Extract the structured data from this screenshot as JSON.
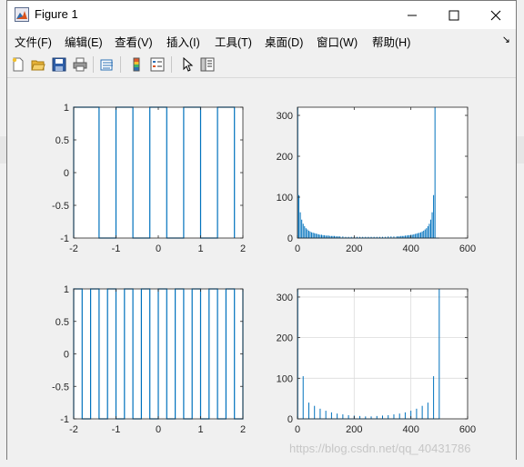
{
  "window": {
    "title": "Figure 1"
  },
  "icons": {
    "title": "matlab-figure-icon",
    "minimize": "minimize-icon",
    "maximize": "maximize-icon",
    "close": "close-icon",
    "new": "new-figure-icon",
    "open": "open-file-icon",
    "save": "save-icon",
    "print": "print-icon",
    "link": "link-plot-icon",
    "colorbar": "colorbar-icon",
    "legend": "legend-icon",
    "pointer": "edit-plot-icon",
    "property": "property-inspector-icon"
  },
  "menu": [
    "文件(F)",
    "编辑(E)",
    "查看(V)",
    "插入(I)",
    "工具(T)",
    "桌面(D)",
    "窗口(W)",
    "帮助(H)"
  ],
  "menu_corner": "↘",
  "watermark": "https://blog.csdn.net/qq_40431786",
  "colors": {
    "line": "#0072bd",
    "axes_bg": "#ffffff",
    "figure_bg": "#f0f0f0",
    "grid": "#dcdcdc"
  },
  "chart_data": [
    {
      "type": "line",
      "title": "",
      "xlabel": "",
      "ylabel": "",
      "xlim": [
        -2,
        2
      ],
      "ylim": [
        -1,
        1
      ],
      "xticks": [
        -2,
        -1,
        0,
        1,
        2
      ],
      "yticks": [
        -1,
        -0.5,
        0,
        0.5,
        1
      ],
      "xtick_labels": [
        "-2",
        "-1",
        "0",
        "1",
        "2"
      ],
      "ytick_labels": [
        "-1",
        "-0.5",
        "0",
        "0.5",
        "1"
      ],
      "grid": false,
      "waveform": "square",
      "period": 0.8,
      "transitions": [
        -1.4,
        -1.0,
        -0.6,
        -0.2,
        0.2,
        0.6,
        1.0,
        1.4,
        1.8
      ],
      "start_value": 1
    },
    {
      "type": "stem",
      "title": "",
      "xlabel": "",
      "ylabel": "",
      "xlim": [
        0,
        600
      ],
      "ylim": [
        0,
        320
      ],
      "xticks": [
        0,
        200,
        400,
        600
      ],
      "yticks": [
        0,
        100,
        200,
        300
      ],
      "xtick_labels": [
        "0",
        "200",
        "400",
        "600"
      ],
      "ytick_labels": [
        "0",
        "100",
        "200",
        "300"
      ],
      "grid": false,
      "x": [
        1,
        5,
        10,
        15,
        20,
        25,
        30,
        35,
        40,
        45,
        50,
        55,
        60,
        65,
        70,
        75,
        80,
        85,
        90,
        95,
        100,
        105,
        110,
        115,
        120,
        125,
        130,
        135,
        140,
        145,
        150,
        160,
        170,
        180,
        190,
        200,
        210,
        220,
        230,
        240,
        250,
        260,
        270,
        280,
        290,
        300,
        310,
        320,
        330,
        340,
        350,
        355,
        360,
        365,
        370,
        375,
        380,
        385,
        390,
        395,
        400,
        405,
        410,
        415,
        420,
        425,
        430,
        435,
        440,
        445,
        450,
        455,
        460,
        465,
        470,
        475,
        480,
        485,
        490,
        495,
        500
      ],
      "y": [
        320,
        105,
        63,
        45,
        35,
        29,
        24,
        21,
        18,
        16,
        14,
        13,
        12,
        11,
        10,
        9,
        8,
        8,
        7,
        7,
        6,
        6,
        6,
        5,
        5,
        5,
        5,
        4,
        4,
        4,
        4,
        4,
        3,
        3,
        3,
        3,
        3,
        3,
        3,
        3,
        3,
        3,
        3,
        3,
        3,
        3,
        3,
        4,
        4,
        4,
        4,
        4,
        4,
        5,
        5,
        5,
        6,
        6,
        7,
        7,
        8,
        8,
        9,
        10,
        11,
        12,
        13,
        14,
        16,
        18,
        21,
        24,
        29,
        35,
        45,
        63,
        105,
        320,
        0,
        0,
        0
      ]
    },
    {
      "type": "line",
      "title": "",
      "xlabel": "",
      "ylabel": "",
      "xlim": [
        -2,
        2
      ],
      "ylim": [
        -1,
        1
      ],
      "xticks": [
        -2,
        -1,
        0,
        1,
        2
      ],
      "yticks": [
        -1,
        -0.5,
        0,
        0.5,
        1
      ],
      "xtick_labels": [
        "-2",
        "-1",
        "0",
        "1",
        "2"
      ],
      "ytick_labels": [
        "-1",
        "-0.5",
        "0",
        "0.5",
        "1"
      ],
      "grid": false,
      "waveform": "square",
      "period": 0.4,
      "transitions": [
        -1.8,
        -1.6,
        -1.4,
        -1.2,
        -1.0,
        -0.8,
        -0.6,
        -0.4,
        -0.2,
        0.0,
        0.2,
        0.4,
        0.6,
        0.8,
        1.0,
        1.2,
        1.4,
        1.6,
        1.8,
        2.0
      ],
      "start_value": 1
    },
    {
      "type": "stem",
      "title": "",
      "xlabel": "",
      "ylabel": "",
      "xlim": [
        0,
        600
      ],
      "ylim": [
        0,
        320
      ],
      "xticks": [
        0,
        200,
        400,
        600
      ],
      "yticks": [
        0,
        100,
        200,
        300
      ],
      "xtick_labels": [
        "0",
        "200",
        "400",
        "600"
      ],
      "ytick_labels": [
        "0",
        "100",
        "200",
        "300"
      ],
      "grid": true,
      "x": [
        1,
        20,
        40,
        60,
        80,
        100,
        120,
        140,
        160,
        180,
        200,
        220,
        240,
        260,
        280,
        300,
        320,
        340,
        360,
        380,
        400,
        420,
        440,
        460,
        480,
        500
      ],
      "y": [
        320,
        105,
        40,
        32,
        25,
        20,
        16,
        13,
        11,
        9,
        8,
        7,
        6,
        6,
        7,
        8,
        9,
        11,
        13,
        16,
        20,
        25,
        32,
        40,
        105,
        320
      ]
    }
  ]
}
